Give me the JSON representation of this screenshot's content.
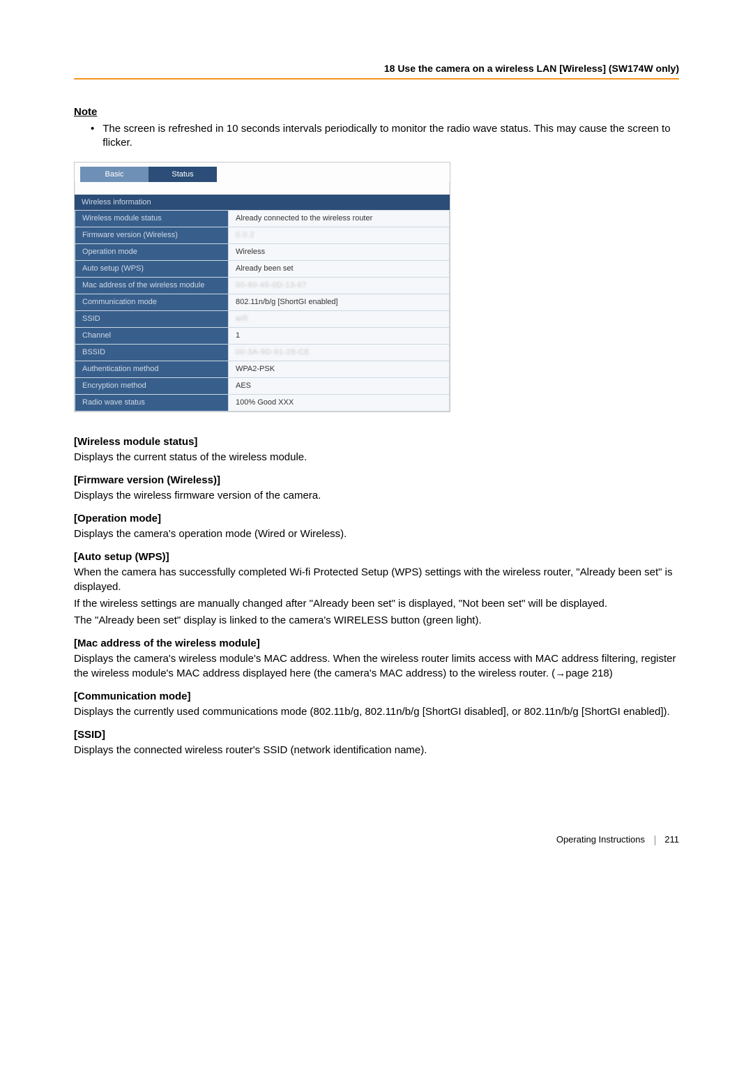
{
  "header": {
    "title": "18 Use the camera on a wireless LAN [Wireless] (SW174W only)"
  },
  "note": {
    "heading": "Note",
    "bullet_text": "The screen is refreshed in 10 seconds intervals periodically to monitor the radio wave status. This may cause the screen to flicker."
  },
  "panel": {
    "tabs": {
      "basic": "Basic",
      "status": "Status"
    },
    "section_title": "Wireless information",
    "rows": [
      {
        "label": "Wireless module status",
        "value": "Already connected to the wireless router"
      },
      {
        "label": "Firmware version (Wireless)",
        "value": "0.0.2",
        "blurred": true
      },
      {
        "label": "Operation mode",
        "value": "Wireless"
      },
      {
        "label": "Auto setup (WPS)",
        "value": "Already been set"
      },
      {
        "label": "Mac address of the wireless module",
        "value": "00-80-45-0D-13-67",
        "blurred": true
      },
      {
        "label": "Communication mode",
        "value": "802.11n/b/g [ShortGI enabled]"
      },
      {
        "label": "SSID",
        "value": "wifi",
        "blurred": true
      },
      {
        "label": "Channel",
        "value": "1"
      },
      {
        "label": "BSSID",
        "value": "00-3A-9D-91-28-CE",
        "blurred": true
      },
      {
        "label": "Authentication method",
        "value": "WPA2-PSK"
      },
      {
        "label": "Encryption method",
        "value": "AES"
      },
      {
        "label": "Radio wave status",
        "value": "100%  Good   XXX"
      }
    ]
  },
  "fields": [
    {
      "title": "[Wireless module status]",
      "body": "Displays the current status of the wireless module."
    },
    {
      "title": "[Firmware version (Wireless)]",
      "body": "Displays the wireless firmware version of the camera."
    },
    {
      "title": "[Operation mode]",
      "body": "Displays the camera's operation mode (Wired or Wireless)."
    },
    {
      "title": "[Auto setup (WPS)]",
      "body": "When the camera has successfully completed Wi-fi Protected Setup (WPS) settings with the wireless router, \"Already been set\" is displayed.\nIf the wireless settings are manually changed after \"Already been set\" is displayed, \"Not been set\" will be displayed.\nThe \"Already been set\" display is linked to the camera's WIRELESS button (green light)."
    },
    {
      "title": "[Mac address of the wireless module]",
      "body": "Displays the camera's wireless module's MAC address. When the wireless router limits access with MAC address filtering, register the wireless module's MAC address displayed here (the camera's MAC address) to the wireless router. (→page 218)"
    },
    {
      "title": "[Communication mode]",
      "body": "Displays the currently used communications mode (802.11b/g, 802.11n/b/g [ShortGI disabled], or 802.11n/b/g [ShortGI enabled])."
    },
    {
      "title": "[SSID]",
      "body": "Displays the connected wireless router's SSID (network identification name)."
    }
  ],
  "footer": {
    "label": "Operating Instructions",
    "page": "211"
  }
}
